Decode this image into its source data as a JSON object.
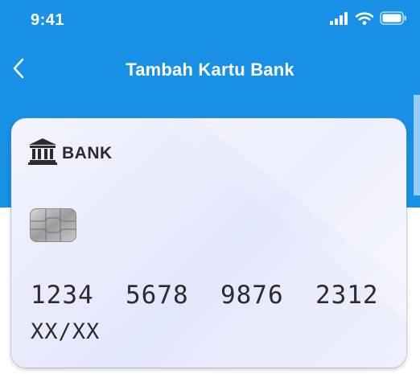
{
  "status_bar": {
    "time": "9:41",
    "signal_icon": "cellular-signal-icon",
    "wifi_icon": "wifi-icon",
    "battery_icon": "battery-icon"
  },
  "nav": {
    "back_icon": "chevron-left-icon",
    "title": "Tambah Kartu Bank"
  },
  "card": {
    "bank_icon": "bank-building-icon",
    "bank_name": "BANK",
    "chip_icon": "chip-icon",
    "number": "1234  5678  9876  2312",
    "expiry": "XX/XX"
  },
  "colors": {
    "header": "#1790e6",
    "card_text": "#2c2c2c",
    "card_bg": "#eceefd"
  }
}
